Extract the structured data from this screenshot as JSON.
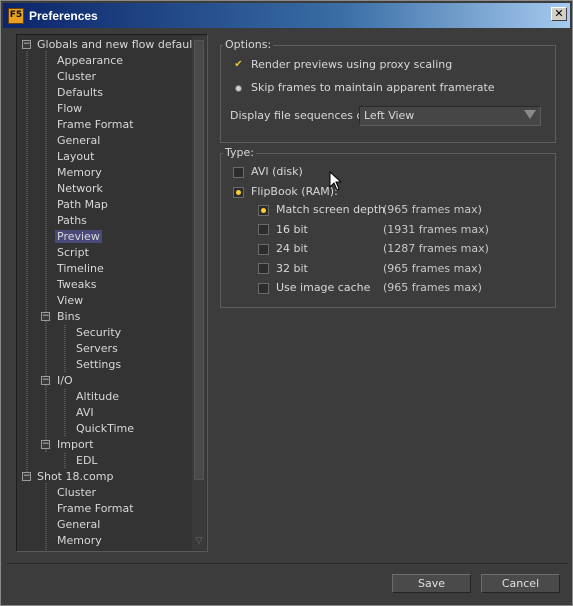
{
  "window": {
    "title": "Preferences",
    "app_icon_text": "F5",
    "close_glyph": "✕"
  },
  "tree": {
    "items": [
      {
        "label": "Globals and new flow defaults",
        "level": 0,
        "expander": "−"
      },
      {
        "label": "Appearance",
        "level": 1
      },
      {
        "label": "Cluster",
        "level": 1
      },
      {
        "label": "Defaults",
        "level": 1
      },
      {
        "label": "Flow",
        "level": 1
      },
      {
        "label": "Frame Format",
        "level": 1
      },
      {
        "label": "General",
        "level": 1
      },
      {
        "label": "Layout",
        "level": 1
      },
      {
        "label": "Memory",
        "level": 1
      },
      {
        "label": "Network",
        "level": 1
      },
      {
        "label": "Path Map",
        "level": 1
      },
      {
        "label": "Paths",
        "level": 1
      },
      {
        "label": "Preview",
        "level": 1,
        "selected": true
      },
      {
        "label": "Script",
        "level": 1
      },
      {
        "label": "Timeline",
        "level": 1
      },
      {
        "label": "Tweaks",
        "level": 1
      },
      {
        "label": "View",
        "level": 1
      },
      {
        "label": "Bins",
        "level": 1,
        "expander": "−"
      },
      {
        "label": "Security",
        "level": 2
      },
      {
        "label": "Servers",
        "level": 2
      },
      {
        "label": "Settings",
        "level": 2
      },
      {
        "label": "I/O",
        "level": 1,
        "expander": "−"
      },
      {
        "label": "Altitude",
        "level": 2
      },
      {
        "label": "AVI",
        "level": 2
      },
      {
        "label": "QuickTime",
        "level": 2
      },
      {
        "label": "Import",
        "level": 1,
        "expander": "−"
      },
      {
        "label": "EDL",
        "level": 2
      },
      {
        "label": "Shot 18.comp",
        "level": 0,
        "expander": "−"
      },
      {
        "label": "Cluster",
        "level": 1
      },
      {
        "label": "Frame Format",
        "level": 1
      },
      {
        "label": "General",
        "level": 1
      },
      {
        "label": "Memory",
        "level": 1
      }
    ]
  },
  "options": {
    "group_label": "Options:",
    "proxy_label": "Render previews using proxy scaling",
    "skip_label": "Skip frames to maintain apparent framerate",
    "display_label": "Display file sequences on:",
    "display_value": "Left View"
  },
  "type": {
    "group_label": "Type:",
    "avi_label": "AVI (disk)",
    "flipbook_label": "FlipBook (RAM):",
    "sub_options": [
      {
        "label": "Match screen depth",
        "frames": "(965 frames max)",
        "state": "radio-on"
      },
      {
        "label": "16 bit",
        "frames": "(1931 frames max)",
        "state": "off"
      },
      {
        "label": "24 bit",
        "frames": "(1287 frames max)",
        "state": "off"
      },
      {
        "label": "32 bit",
        "frames": "(965 frames max)",
        "state": "off"
      },
      {
        "label": "Use image cache",
        "frames": "(965 frames max)",
        "state": "off"
      }
    ]
  },
  "buttons": {
    "save": "Save",
    "cancel": "Cancel"
  },
  "colors": {
    "selected_bg": "#4a4a7a",
    "check_accent": "#e8c040",
    "radio_accent": "#ffcc33"
  }
}
